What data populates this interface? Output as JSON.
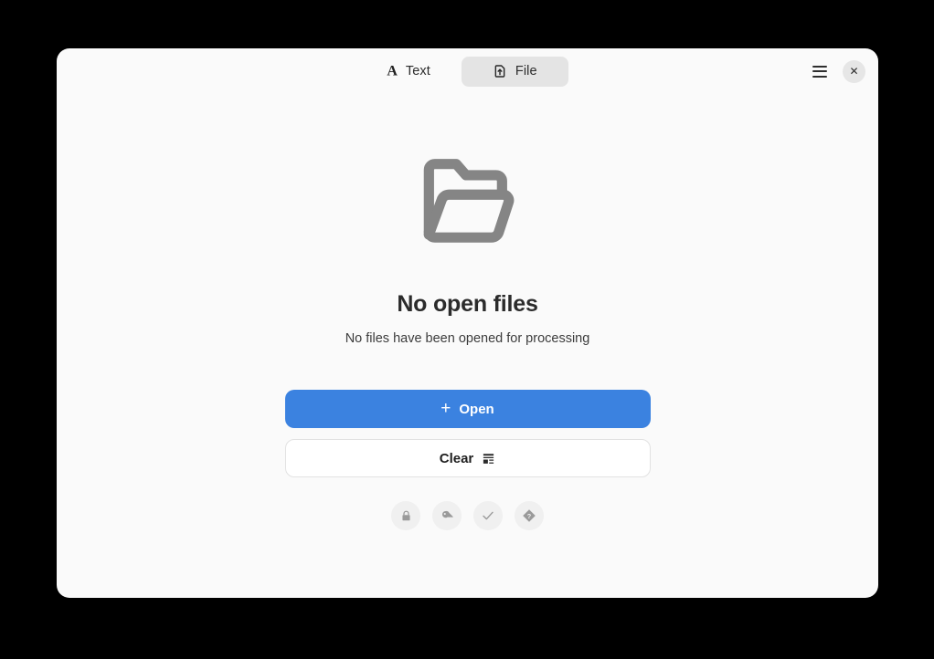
{
  "window": {
    "mode_tabs": [
      {
        "label": "Text",
        "icon": "serif-a-icon",
        "active": false
      },
      {
        "label": "File",
        "icon": "file-upload-icon",
        "active": true
      }
    ],
    "controls": {
      "menu_icon": "hamburger-menu-icon",
      "close_icon": "close-icon",
      "close_glyph": "✕"
    }
  },
  "empty_state": {
    "icon": "open-folder-icon",
    "title": "No open files",
    "subtitle": "No files have been opened for processing"
  },
  "actions": {
    "open": {
      "label": "Open",
      "icon": "plus-icon",
      "glyph": "+"
    },
    "clear": {
      "label": "Clear",
      "icon": "list-layout-icon"
    }
  },
  "status_icons": [
    {
      "name": "lock-icon"
    },
    {
      "name": "key-icon"
    },
    {
      "name": "check-icon"
    },
    {
      "name": "help-diamond-icon"
    }
  ],
  "colors": {
    "accent": "#3b82e0",
    "window_bg": "#fafafa",
    "desktop_bg": "#000000",
    "active_tab_bg": "#e4e4e4",
    "icon_gray": "#858585",
    "status_icon_gray": "#9a9a9a"
  }
}
